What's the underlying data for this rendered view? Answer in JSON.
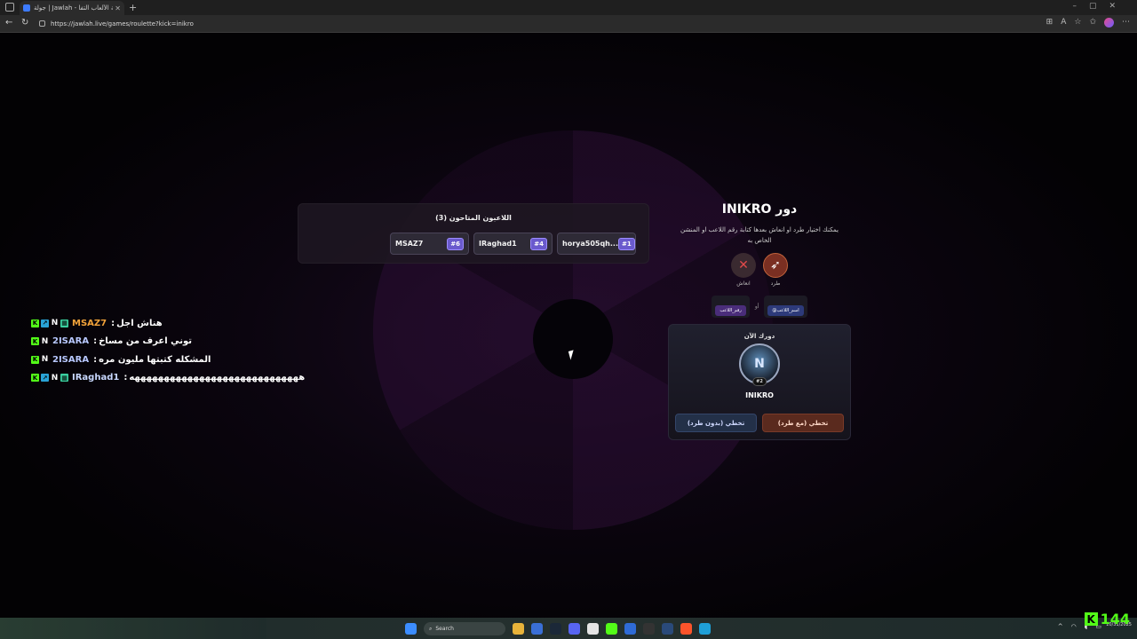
{
  "browser": {
    "tab_title": "جولة | Jawlah - منصة الألعاب التفا...",
    "url": "https://jawlah.live/games/roulette?kick=inikro"
  },
  "players_panel": {
    "title": "اللاعبون المتاحون (3)",
    "players": [
      {
        "name": "MSAZ7",
        "number": "#6"
      },
      {
        "name": "IRaghad1",
        "number": "#4"
      },
      {
        "name": "horya505qh...",
        "number": "#1"
      }
    ]
  },
  "turn_panel": {
    "title": "دور INIKRO",
    "description": "يمكنك اختيار طرد او انعاش بعدها كتابة رقم اللاعب او المنشن الخاص به",
    "actions": {
      "kick": "طرد",
      "revive": "انعاش"
    },
    "formats": {
      "player_name": "@اسم_اللاعب",
      "or": "أو",
      "player_number": "رقم_اللاعب"
    },
    "card": {
      "label": "دورك الآن",
      "avatar_badge": "#2",
      "player_name": "INIKRO",
      "skip_with_kick": "تخطي (مع طرد)",
      "skip_without_kick": "تخطي (بدون طرد)"
    }
  },
  "chat": [
    {
      "user": "MSAZ7",
      "user_color": "#f2a33a",
      "text": "هناش اجل"
    },
    {
      "user": "2ISARA",
      "user_color": "#b8c8ff",
      "text": "توني اعرف من مساخ"
    },
    {
      "user": "2ISARA",
      "user_color": "#b8c8ff",
      "text": "المشكله كتبتها مليون مره"
    },
    {
      "user": "IRaghad1",
      "user_color": "#c8d8ff",
      "text": "هههههههههههههههههههههههههههههه"
    }
  ],
  "taskbar": {
    "search": "Search",
    "time": "",
    "date": "10/31/2025"
  },
  "kick_viewers": "144",
  "colors": {
    "kick_green": "#53fc18",
    "accent_purple": "#6a5acd"
  }
}
